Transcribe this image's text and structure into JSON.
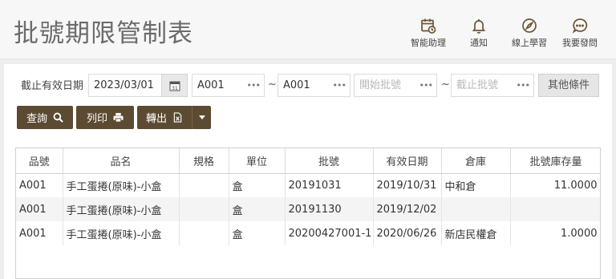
{
  "page": {
    "title": "批號期限管制表"
  },
  "header_nav": [
    {
      "label": "智能助理",
      "icon": "calendar-clock-icon"
    },
    {
      "label": "通知",
      "icon": "bell-icon"
    },
    {
      "label": "線上學習",
      "icon": "compass-icon"
    },
    {
      "label": "我要發問",
      "icon": "chat-bubble-icon"
    }
  ],
  "filters": {
    "expiry_label": "截止有效日期",
    "expiry_date": "2023/03/01",
    "item_from": "A001",
    "item_to": "A001",
    "range_sep": "~",
    "batch_start_placeholder": "開始批號",
    "batch_end_placeholder": "截止批號",
    "more_conditions": "其他條件"
  },
  "actions": {
    "query": "查詢",
    "print": "列印",
    "export": "轉出"
  },
  "table": {
    "columns": [
      "品號",
      "品名",
      "規格",
      "單位",
      "批號",
      "有效日期",
      "倉庫",
      "批號庫存量"
    ],
    "rows": [
      [
        "A001",
        "手工蛋捲(原味)-小盒",
        "",
        "盒",
        "20191031",
        "2019/10/31",
        "中和倉",
        "11.0000"
      ],
      [
        "A001",
        "手工蛋捲(原味)-小盒",
        "",
        "盒",
        "20191130",
        "2019/12/02",
        "",
        ""
      ],
      [
        "A001",
        "手工蛋捲(原味)-小盒",
        "",
        "盒",
        "20200427001-1",
        "2020/06/26",
        "新店民權倉",
        "1.0000"
      ]
    ]
  },
  "colors": {
    "accent": "#5c4a32",
    "icon": "#6b5636"
  }
}
